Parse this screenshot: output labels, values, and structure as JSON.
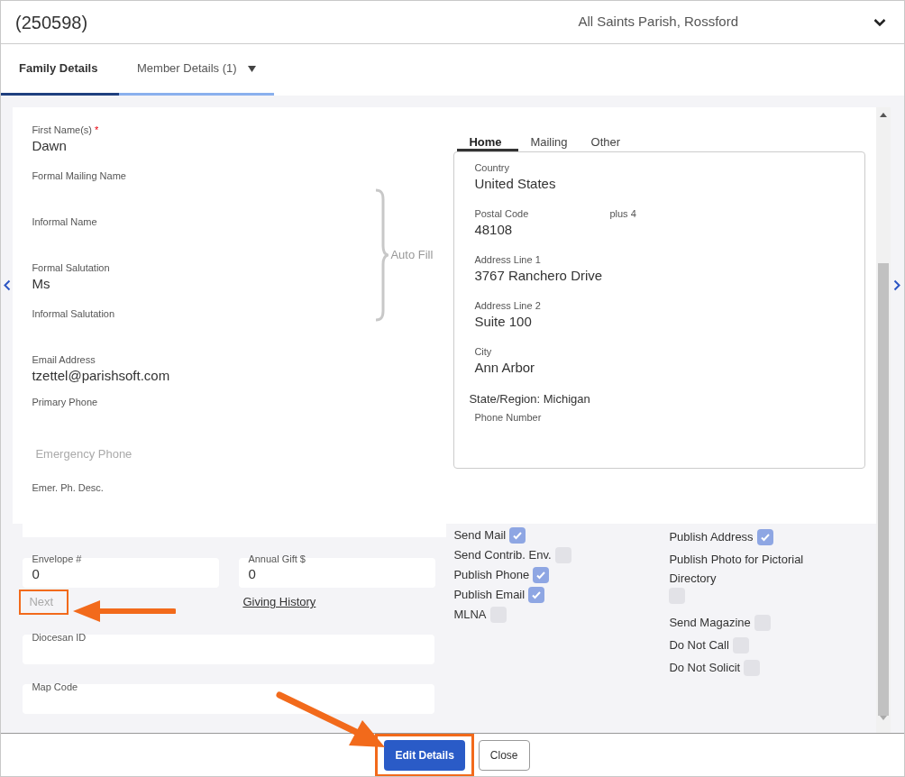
{
  "header": {
    "record_id": "(250598)",
    "parish": "All Saints Parish, Rossford"
  },
  "tabs": [
    {
      "label": "Family Details",
      "selected": true,
      "dropdown": false
    },
    {
      "label": "Member Details (1)",
      "selected": false,
      "dropdown": true
    }
  ],
  "name_fields": [
    {
      "label": "First Name(s)",
      "value": "Dawn",
      "required_mark": "*"
    },
    {
      "label": "Formal Mailing Name"
    },
    {
      "label": "Informal Name"
    },
    {
      "label": "Formal Salutation",
      "value": "Ms"
    },
    {
      "label": "Informal Salutation"
    }
  ],
  "auto_fill": "Auto Fill",
  "contact_fields": [
    {
      "kind": "field",
      "label": "Email Address",
      "value": "tzettel@parishsoft.com"
    },
    {
      "kind": "field",
      "label": "Primary Phone"
    },
    {
      "kind": "placeholder",
      "label": "Emergency Phone"
    },
    {
      "kind": "field",
      "label": "Emer. Ph. Desc."
    }
  ],
  "envelope": {
    "label": "Envelope #",
    "value": "0",
    "link": "Next"
  },
  "annual_gift": {
    "label": "Annual Gift $",
    "value": "0",
    "link": "Giving History"
  },
  "lower_fields": [
    {
      "label": "Diocesan ID"
    },
    {
      "label": "Map Code"
    }
  ],
  "address": {
    "tabs": [
      {
        "label": "Home",
        "selected": true
      },
      {
        "label": "Mailing",
        "selected": false
      },
      {
        "label": "Other",
        "selected": false
      }
    ],
    "fields": [
      {
        "label": "Country",
        "value": "United States"
      },
      {
        "label": "Postal Code",
        "value": "48108",
        "extra_label": "plus 4"
      },
      {
        "label": "Address Line 1",
        "value": "3767 Ranchero Drive"
      },
      {
        "label": "Address Line 2",
        "value": "Suite 100"
      },
      {
        "label": "City",
        "value": "Ann Arbor"
      }
    ],
    "state": "State/Region: Michigan",
    "phone_label": "Phone Number"
  },
  "options_left": [
    {
      "label": "Send Mail",
      "checked": true
    },
    {
      "label": "Send Contrib. Env.",
      "checked": false
    },
    {
      "label": "Publish Phone",
      "checked": true
    },
    {
      "label": "Publish Email",
      "checked": true
    },
    {
      "label": "MLNA",
      "checked": false
    }
  ],
  "options_right": [
    {
      "label": "Publish Address",
      "checked": true
    },
    {
      "label": "Publish Photo for Pictorial Directory",
      "checked": false,
      "box_below": true
    },
    {
      "label": "Send Magazine",
      "checked": false
    },
    {
      "label": "Do Not Call",
      "checked": false
    },
    {
      "label": "Do Not Solicit",
      "checked": false
    }
  ],
  "buttons": [
    {
      "label": "Edit Details",
      "kind": "primary",
      "highlighted": true
    },
    {
      "label": "Close",
      "kind": "secondary",
      "highlighted": false
    }
  ]
}
